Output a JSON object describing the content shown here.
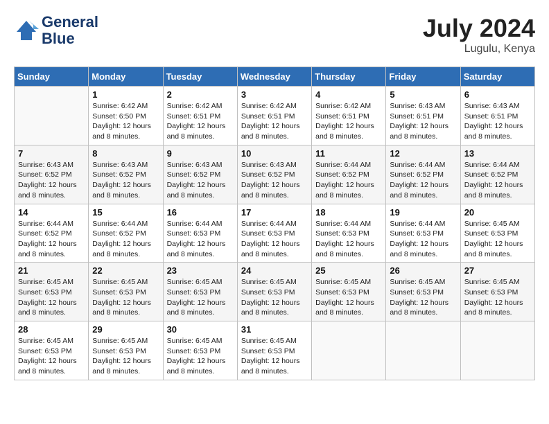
{
  "header": {
    "logo_line1": "General",
    "logo_line2": "Blue",
    "month_year": "July 2024",
    "location": "Lugulu, Kenya"
  },
  "weekdays": [
    "Sunday",
    "Monday",
    "Tuesday",
    "Wednesday",
    "Thursday",
    "Friday",
    "Saturday"
  ],
  "weeks": [
    [
      {
        "day": "",
        "sunrise": "",
        "sunset": "",
        "daylight": ""
      },
      {
        "day": "1",
        "sunrise": "Sunrise: 6:42 AM",
        "sunset": "Sunset: 6:50 PM",
        "daylight": "Daylight: 12 hours and 8 minutes."
      },
      {
        "day": "2",
        "sunrise": "Sunrise: 6:42 AM",
        "sunset": "Sunset: 6:51 PM",
        "daylight": "Daylight: 12 hours and 8 minutes."
      },
      {
        "day": "3",
        "sunrise": "Sunrise: 6:42 AM",
        "sunset": "Sunset: 6:51 PM",
        "daylight": "Daylight: 12 hours and 8 minutes."
      },
      {
        "day": "4",
        "sunrise": "Sunrise: 6:42 AM",
        "sunset": "Sunset: 6:51 PM",
        "daylight": "Daylight: 12 hours and 8 minutes."
      },
      {
        "day": "5",
        "sunrise": "Sunrise: 6:43 AM",
        "sunset": "Sunset: 6:51 PM",
        "daylight": "Daylight: 12 hours and 8 minutes."
      },
      {
        "day": "6",
        "sunrise": "Sunrise: 6:43 AM",
        "sunset": "Sunset: 6:51 PM",
        "daylight": "Daylight: 12 hours and 8 minutes."
      }
    ],
    [
      {
        "day": "7",
        "sunrise": "Sunrise: 6:43 AM",
        "sunset": "Sunset: 6:52 PM",
        "daylight": "Daylight: 12 hours and 8 minutes."
      },
      {
        "day": "8",
        "sunrise": "Sunrise: 6:43 AM",
        "sunset": "Sunset: 6:52 PM",
        "daylight": "Daylight: 12 hours and 8 minutes."
      },
      {
        "day": "9",
        "sunrise": "Sunrise: 6:43 AM",
        "sunset": "Sunset: 6:52 PM",
        "daylight": "Daylight: 12 hours and 8 minutes."
      },
      {
        "day": "10",
        "sunrise": "Sunrise: 6:43 AM",
        "sunset": "Sunset: 6:52 PM",
        "daylight": "Daylight: 12 hours and 8 minutes."
      },
      {
        "day": "11",
        "sunrise": "Sunrise: 6:44 AM",
        "sunset": "Sunset: 6:52 PM",
        "daylight": "Daylight: 12 hours and 8 minutes."
      },
      {
        "day": "12",
        "sunrise": "Sunrise: 6:44 AM",
        "sunset": "Sunset: 6:52 PM",
        "daylight": "Daylight: 12 hours and 8 minutes."
      },
      {
        "day": "13",
        "sunrise": "Sunrise: 6:44 AM",
        "sunset": "Sunset: 6:52 PM",
        "daylight": "Daylight: 12 hours and 8 minutes."
      }
    ],
    [
      {
        "day": "14",
        "sunrise": "Sunrise: 6:44 AM",
        "sunset": "Sunset: 6:52 PM",
        "daylight": "Daylight: 12 hours and 8 minutes."
      },
      {
        "day": "15",
        "sunrise": "Sunrise: 6:44 AM",
        "sunset": "Sunset: 6:52 PM",
        "daylight": "Daylight: 12 hours and 8 minutes."
      },
      {
        "day": "16",
        "sunrise": "Sunrise: 6:44 AM",
        "sunset": "Sunset: 6:53 PM",
        "daylight": "Daylight: 12 hours and 8 minutes."
      },
      {
        "day": "17",
        "sunrise": "Sunrise: 6:44 AM",
        "sunset": "Sunset: 6:53 PM",
        "daylight": "Daylight: 12 hours and 8 minutes."
      },
      {
        "day": "18",
        "sunrise": "Sunrise: 6:44 AM",
        "sunset": "Sunset: 6:53 PM",
        "daylight": "Daylight: 12 hours and 8 minutes."
      },
      {
        "day": "19",
        "sunrise": "Sunrise: 6:44 AM",
        "sunset": "Sunset: 6:53 PM",
        "daylight": "Daylight: 12 hours and 8 minutes."
      },
      {
        "day": "20",
        "sunrise": "Sunrise: 6:45 AM",
        "sunset": "Sunset: 6:53 PM",
        "daylight": "Daylight: 12 hours and 8 minutes."
      }
    ],
    [
      {
        "day": "21",
        "sunrise": "Sunrise: 6:45 AM",
        "sunset": "Sunset: 6:53 PM",
        "daylight": "Daylight: 12 hours and 8 minutes."
      },
      {
        "day": "22",
        "sunrise": "Sunrise: 6:45 AM",
        "sunset": "Sunset: 6:53 PM",
        "daylight": "Daylight: 12 hours and 8 minutes."
      },
      {
        "day": "23",
        "sunrise": "Sunrise: 6:45 AM",
        "sunset": "Sunset: 6:53 PM",
        "daylight": "Daylight: 12 hours and 8 minutes."
      },
      {
        "day": "24",
        "sunrise": "Sunrise: 6:45 AM",
        "sunset": "Sunset: 6:53 PM",
        "daylight": "Daylight: 12 hours and 8 minutes."
      },
      {
        "day": "25",
        "sunrise": "Sunrise: 6:45 AM",
        "sunset": "Sunset: 6:53 PM",
        "daylight": "Daylight: 12 hours and 8 minutes."
      },
      {
        "day": "26",
        "sunrise": "Sunrise: 6:45 AM",
        "sunset": "Sunset: 6:53 PM",
        "daylight": "Daylight: 12 hours and 8 minutes."
      },
      {
        "day": "27",
        "sunrise": "Sunrise: 6:45 AM",
        "sunset": "Sunset: 6:53 PM",
        "daylight": "Daylight: 12 hours and 8 minutes."
      }
    ],
    [
      {
        "day": "28",
        "sunrise": "Sunrise: 6:45 AM",
        "sunset": "Sunset: 6:53 PM",
        "daylight": "Daylight: 12 hours and 8 minutes."
      },
      {
        "day": "29",
        "sunrise": "Sunrise: 6:45 AM",
        "sunset": "Sunset: 6:53 PM",
        "daylight": "Daylight: 12 hours and 8 minutes."
      },
      {
        "day": "30",
        "sunrise": "Sunrise: 6:45 AM",
        "sunset": "Sunset: 6:53 PM",
        "daylight": "Daylight: 12 hours and 8 minutes."
      },
      {
        "day": "31",
        "sunrise": "Sunrise: 6:45 AM",
        "sunset": "Sunset: 6:53 PM",
        "daylight": "Daylight: 12 hours and 8 minutes."
      },
      {
        "day": "",
        "sunrise": "",
        "sunset": "",
        "daylight": ""
      },
      {
        "day": "",
        "sunrise": "",
        "sunset": "",
        "daylight": ""
      },
      {
        "day": "",
        "sunrise": "",
        "sunset": "",
        "daylight": ""
      }
    ]
  ]
}
